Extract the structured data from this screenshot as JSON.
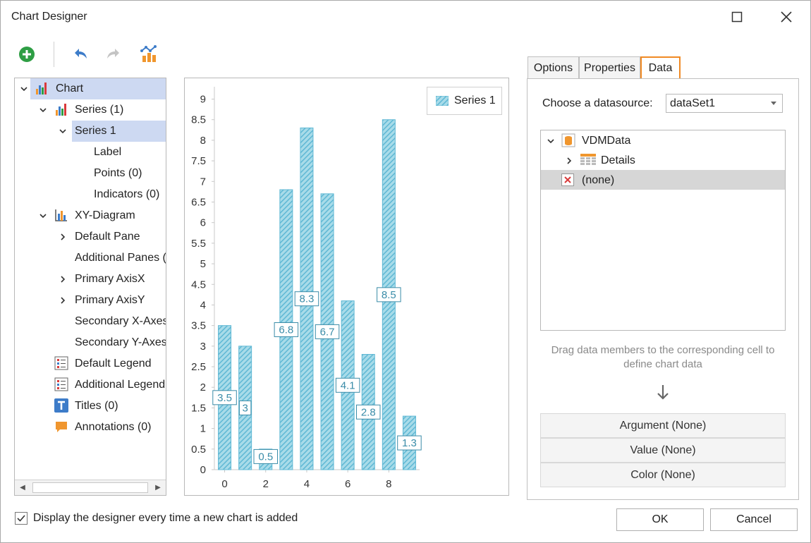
{
  "window": {
    "title": "Chart Designer"
  },
  "toolbar": {
    "add_icon": "add-circle-icon",
    "undo_icon": "undo-icon",
    "redo_icon": "redo-icon",
    "wizard_icon": "chart-wizard-icon"
  },
  "tree": {
    "items": [
      {
        "label": "Chart",
        "icon": "bar-chart-icon",
        "expanded": true,
        "selected": true
      },
      {
        "label": "Series (1)",
        "icon": "bar-chart-icon",
        "expanded": true
      },
      {
        "label": "Series 1",
        "expanded": true,
        "selected": true
      },
      {
        "label": "Label"
      },
      {
        "label": "Points (0)"
      },
      {
        "label": "Indicators (0)"
      },
      {
        "label": "XY-Diagram",
        "icon": "diagram-icon",
        "expanded": true
      },
      {
        "label": "Default Pane",
        "collapsed": true
      },
      {
        "label": "Additional Panes ("
      },
      {
        "label": "Primary AxisX",
        "collapsed": true
      },
      {
        "label": "Primary AxisY",
        "collapsed": true
      },
      {
        "label": "Secondary X-Axes"
      },
      {
        "label": "Secondary Y-Axes"
      },
      {
        "label": "Default Legend",
        "icon": "legend-icon"
      },
      {
        "label": "Additional Legend",
        "icon": "legend-icon"
      },
      {
        "label": "Titles (0)",
        "icon": "title-icon"
      },
      {
        "label": "Annotations (0)",
        "icon": "annotation-icon"
      }
    ]
  },
  "chart_data": {
    "type": "bar",
    "x": [
      0,
      1,
      2,
      3,
      4,
      5,
      6,
      7,
      8,
      9
    ],
    "values": [
      3.5,
      3,
      0.5,
      6.8,
      8.3,
      6.7,
      4.1,
      2.8,
      8.5,
      1.3
    ],
    "labels": [
      "3.5",
      "3",
      "0.5",
      "6.8",
      "8.3",
      "6.7",
      "4.1",
      "2.8",
      "8.5",
      "1.3"
    ],
    "xticks": [
      "0",
      "2",
      "4",
      "6",
      "8"
    ],
    "yticks": [
      "0",
      "0.5",
      "1",
      "1.5",
      "2",
      "2.5",
      "3",
      "3.5",
      "4",
      "4.5",
      "5",
      "5.5",
      "6",
      "6.5",
      "7",
      "7.5",
      "8",
      "8.5",
      "9"
    ],
    "ylim": [
      0,
      9.3
    ],
    "xlim": [
      -0.5,
      9.5
    ],
    "legend": {
      "series_name": "Series 1",
      "position": "top-right"
    },
    "bar_color": "#5fb8d4",
    "label_color": "#3a8ca8"
  },
  "tabs": [
    {
      "label": "Options"
    },
    {
      "label": "Properties"
    },
    {
      "label": "Data",
      "active": true
    }
  ],
  "data_tab": {
    "datasource_label": "Choose a datasource:",
    "datasource_value": "dataSet1",
    "tree": [
      {
        "label": "VDMData",
        "icon": "database-icon",
        "expanded": true
      },
      {
        "label": "Details",
        "icon": "table-icon",
        "collapsed": true
      },
      {
        "label": "(none)",
        "icon": "none-icon",
        "selected": true
      }
    ],
    "hint": "Drag data members to the corresponding cell to define chart data",
    "cells": [
      {
        "label": "Argument (None)"
      },
      {
        "label": "Value (None)"
      },
      {
        "label": "Color (None)"
      }
    ]
  },
  "footer": {
    "checkbox_label": "Display the designer every time a new chart is added",
    "checked": true,
    "ok_label": "OK",
    "cancel_label": "Cancel"
  },
  "colors": {
    "accent_tab": "#f08a24",
    "selection": "#cdd9f2"
  }
}
